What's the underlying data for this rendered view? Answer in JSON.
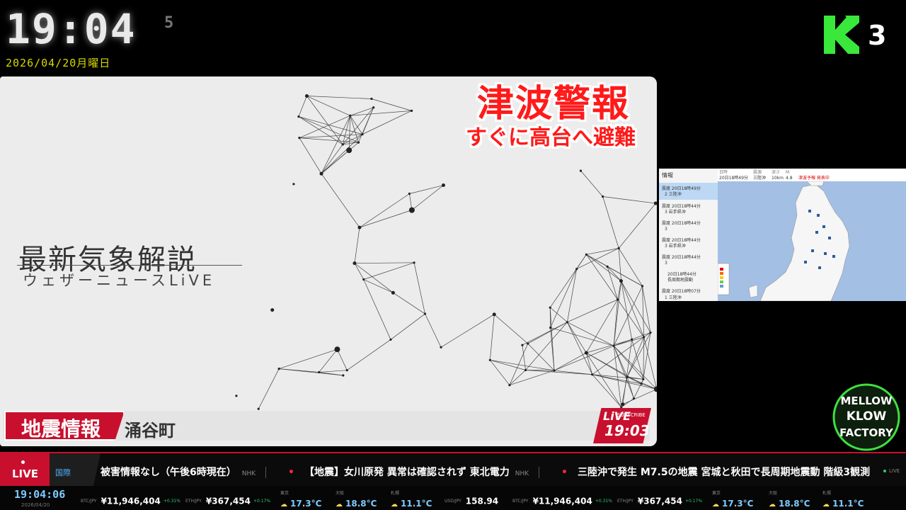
{
  "clock": {
    "time": "19:04",
    "seconds": "5",
    "date": "2026/04/20月曜日"
  },
  "channel": {
    "number": "3"
  },
  "video": {
    "title": "最新気象解説",
    "subtitle": "ウェザーニュースLiVE",
    "alert_main": "津波警報",
    "alert_sub": "すぐに高台へ避難",
    "lower_third_tag": "地震情報",
    "lower_third_location": "涌谷町",
    "live_badge": {
      "live": "LiVE",
      "subscribe": "SUBSCRIBE",
      "time": "19:03"
    }
  },
  "map_panel": {
    "list_title": "情報",
    "header_items": [
      "日時",
      "20日18時49分",
      "震源",
      "三陸沖",
      "深さ",
      "10km",
      "M",
      "4.8",
      "津波予報 発表中"
    ],
    "list_items": [
      {
        "line1": "震度 20日18時49分",
        "line2": "2  三陸沖"
      },
      {
        "line1": "震度 20日18時44分",
        "line2": "3  岩手県沖"
      },
      {
        "line1": "震度 20日18時44分",
        "line2": "3"
      },
      {
        "line1": "震度 20日18時44分",
        "line2": "3  岩手県沖"
      },
      {
        "line1": "震度 20日18時44分",
        "line2": "3"
      },
      {
        "line1": "20日18時44分",
        "line2": "長周期地震動"
      },
      {
        "line1": "震度 20日18時07分",
        "line2": "1  三陸沖"
      }
    ]
  },
  "mk_logo": {
    "line1": "MELLOW",
    "line2": "KLOW",
    "line3": "FACTORY"
  },
  "ticker": {
    "live_label": "LIVE",
    "category": "国際",
    "items": [
      {
        "text": "被害情報なし（午後6時現在）",
        "source": "NHK"
      },
      {
        "text": "【地震】女川原発 異常は確認されず 東北電力",
        "source": "NHK"
      },
      {
        "text": "三陸沖で発生 M7.5の地震 宮城と秋田で長周期地震動 階級3観測",
        "source": ""
      }
    ],
    "end_label": "LIVE"
  },
  "market": {
    "time": "19:04:06",
    "date": "2026/04/20",
    "items": [
      {
        "label": "BTC/JPY",
        "value": "¥11,946,404",
        "change": "+0.31%"
      },
      {
        "label": "ETH/JPY",
        "value": "¥367,454",
        "change": "+0.17%"
      },
      {
        "label": "USD/JPY",
        "value": "158.94",
        "change": ""
      },
      {
        "label": "BTC/JPY",
        "value": "¥11,946,404",
        "change": "+0.31%"
      },
      {
        "label": "ETH/JPY",
        "value": "¥367,454",
        "change": "+0.17%"
      }
    ],
    "weather": [
      {
        "city": "東京",
        "temp": "17.3°C"
      },
      {
        "city": "大阪",
        "temp": "18.8°C"
      },
      {
        "city": "札幌",
        "temp": "11.1°C"
      },
      {
        "city": "東京",
        "temp": "17.3°C"
      },
      {
        "city": "大阪",
        "temp": "18.8°C"
      },
      {
        "city": "札幌",
        "temp": "11.1°C"
      }
    ]
  }
}
